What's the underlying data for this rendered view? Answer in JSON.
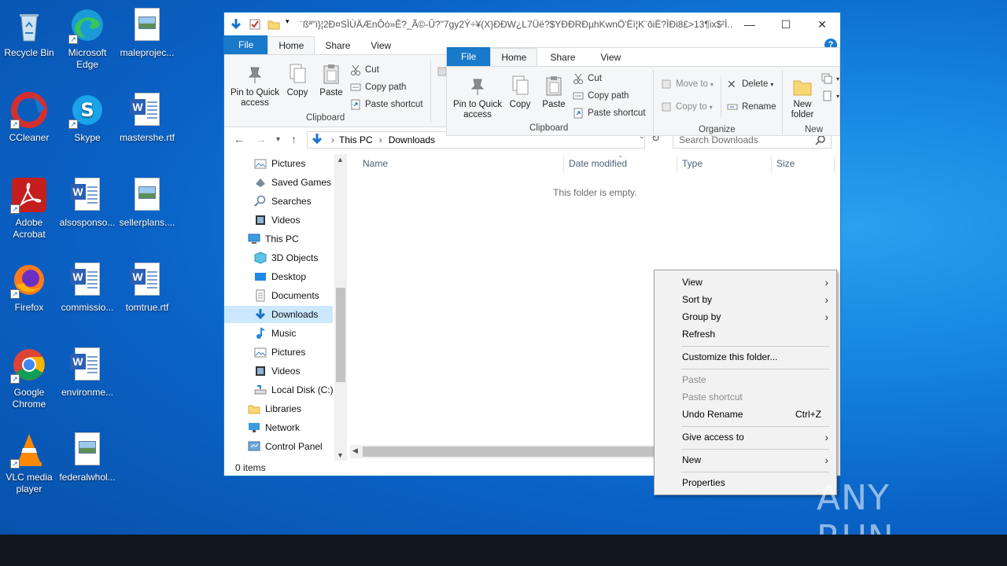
{
  "desktop": {
    "icons": [
      {
        "label": "Recycle Bin"
      },
      {
        "label": "Microsoft Edge"
      },
      {
        "label": "maleprojec..."
      },
      {
        "label": "CCleaner"
      },
      {
        "label": "Skype"
      },
      {
        "label": "mastershe.rtf"
      },
      {
        "label": "Adobe Acrobat"
      },
      {
        "label": "alsosponso..."
      },
      {
        "label": "sellerplans...."
      },
      {
        "label": "Firefox"
      },
      {
        "label": "commissio..."
      },
      {
        "label": "tomtrue.rtf"
      },
      {
        "label": "Google Chrome"
      },
      {
        "label": "environme..."
      },
      {
        "label": "VLC media player"
      },
      {
        "label": "federalwhol..."
      }
    ]
  },
  "window": {
    "title": "¨ßª\"i}¦2Ð¤SÌÙÄÆnÔó»Ê?_Ã©-Û?\"7gy2Ý÷¥(X}ÐÐW¿L7Üë?$YÐÐRÐµhKwnÖ'Ëì¦K¨õiË?ÌÐi8£>13¶ix$²Ì...",
    "caption_minimize": "—",
    "caption_maximize": "☐",
    "caption_close": "✕",
    "help": "?"
  },
  "ribbon": {
    "tabs": {
      "file": "File",
      "home": "Home",
      "share": "Share",
      "view": "View"
    },
    "pin": "Pin to Quick access",
    "copy": "Copy",
    "paste": "Paste",
    "cut": "Cut",
    "copy_path": "Copy path",
    "paste_shortcut": "Paste shortcut",
    "clipboard": "Clipboard"
  },
  "ribbon2": {
    "tabs": {
      "file": "File",
      "home": "Home",
      "share": "Share",
      "view": "View"
    },
    "pin": "Pin to Quick access",
    "copy": "Copy",
    "paste": "Paste",
    "cut": "Cut",
    "copy_path": "Copy path",
    "paste_shortcut": "Paste shortcut",
    "clipboard": "Clipboard",
    "move_to": "Move to",
    "copy_to": "Copy to",
    "delete": "Delete",
    "rename": "Rename",
    "organize": "Organize",
    "new_folder": "New folder",
    "new": "New"
  },
  "address": {
    "crumbs": [
      "This PC",
      "Downloads"
    ],
    "search_placeholder": "Search Downloads"
  },
  "nav": {
    "items": [
      {
        "label": "Pictures"
      },
      {
        "label": "Saved Games"
      },
      {
        "label": "Searches"
      },
      {
        "label": "Videos"
      },
      {
        "label": "This PC"
      },
      {
        "label": "3D Objects"
      },
      {
        "label": "Desktop"
      },
      {
        "label": "Documents"
      },
      {
        "label": "Downloads"
      },
      {
        "label": "Music"
      },
      {
        "label": "Pictures"
      },
      {
        "label": "Videos"
      },
      {
        "label": "Local Disk (C:)"
      },
      {
        "label": "Libraries"
      },
      {
        "label": "Network"
      },
      {
        "label": "Control Panel"
      }
    ],
    "selected": "Downloads"
  },
  "content": {
    "columns": [
      "Name",
      "Date modified",
      "Type",
      "Size"
    ],
    "empty_text": "This folder is empty.",
    "status": "0 items"
  },
  "context_menu": {
    "items": [
      {
        "label": "View",
        "submenu": true
      },
      {
        "label": "Sort by",
        "submenu": true
      },
      {
        "label": "Group by",
        "submenu": true
      },
      {
        "label": "Refresh"
      },
      {
        "label": "Customize this folder..."
      },
      {
        "label": "Paste",
        "disabled": true
      },
      {
        "label": "Paste shortcut",
        "disabled": true
      },
      {
        "label": "Undo Rename",
        "shortcut": "Ctrl+Z"
      },
      {
        "label": "Give access to",
        "submenu": true
      },
      {
        "label": "New",
        "submenu": true
      },
      {
        "label": "Properties"
      }
    ]
  },
  "watermark": "ANY RUN",
  "colors": {
    "accent": "#1979ca",
    "selection": "#cce8ff"
  }
}
